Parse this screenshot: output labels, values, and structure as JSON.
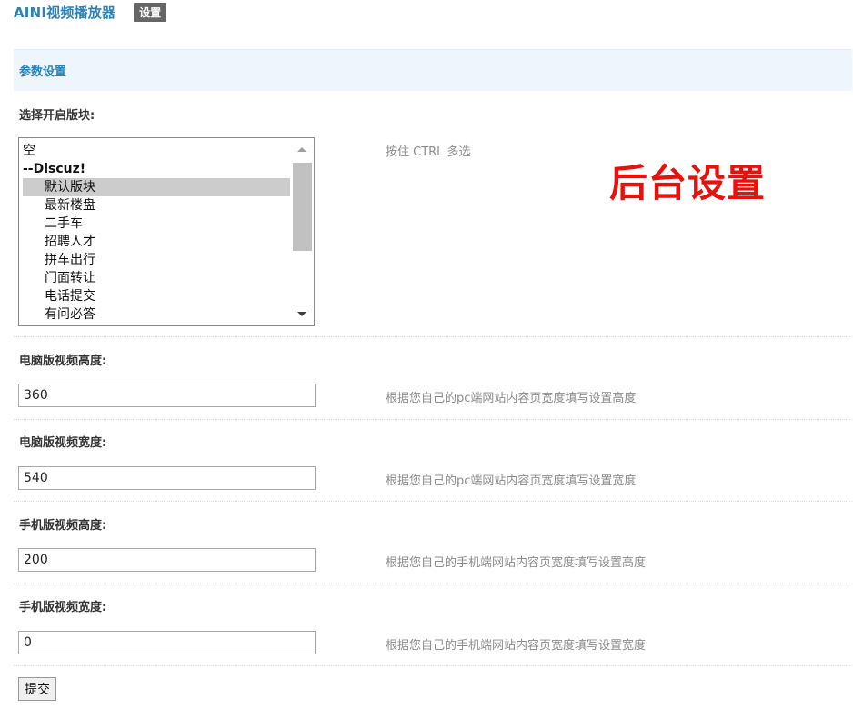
{
  "header": {
    "app_title": "AINI视频播放器",
    "settings_tab": "设置"
  },
  "section": {
    "title": "参数设置"
  },
  "forums": {
    "label": "选择开启版块:",
    "hint": "按住 CTRL 多选",
    "items": [
      {
        "label": "空",
        "type": "option",
        "selected": false
      },
      {
        "label": "--Discuz!",
        "type": "group",
        "selected": false
      },
      {
        "label": "默认版块",
        "type": "option",
        "selected": true
      },
      {
        "label": "最新楼盘",
        "type": "option",
        "selected": false
      },
      {
        "label": "二手车",
        "type": "option",
        "selected": false
      },
      {
        "label": "招聘人才",
        "type": "option",
        "selected": false
      },
      {
        "label": "拼车出行",
        "type": "option",
        "selected": false
      },
      {
        "label": "门面转让",
        "type": "option",
        "selected": false
      },
      {
        "label": "电话提交",
        "type": "option",
        "selected": false
      },
      {
        "label": "有问必答",
        "type": "option",
        "selected": false
      }
    ]
  },
  "overlay_label": "后台设置",
  "fields": {
    "pc_height": {
      "label": "电脑版视频高度:",
      "value": "360",
      "hint": "根据您自己的pc端网站内容页宽度填写设置高度"
    },
    "pc_width": {
      "label": "电脑版视频宽度:",
      "value": "540",
      "hint": "根据您自己的pc端网站内容页宽度填写设置宽度"
    },
    "mobile_height": {
      "label": "手机版视频高度:",
      "value": "200",
      "hint": "根据您自己的手机端网站内容页宽度填写设置高度"
    },
    "mobile_width": {
      "label": "手机版视频宽度:",
      "value": "0",
      "hint": "根据您自己的手机端网站内容页宽度填写设置宽度"
    }
  },
  "submit_label": "提交",
  "colors": {
    "accent": "#2b82b8",
    "section_bg": "#eef5fc",
    "overlay_red": "#e8120c",
    "selected_bg": "#cccccc"
  },
  "icons": {
    "scroll_up": "triangle-up",
    "scroll_down": "triangle-down"
  }
}
